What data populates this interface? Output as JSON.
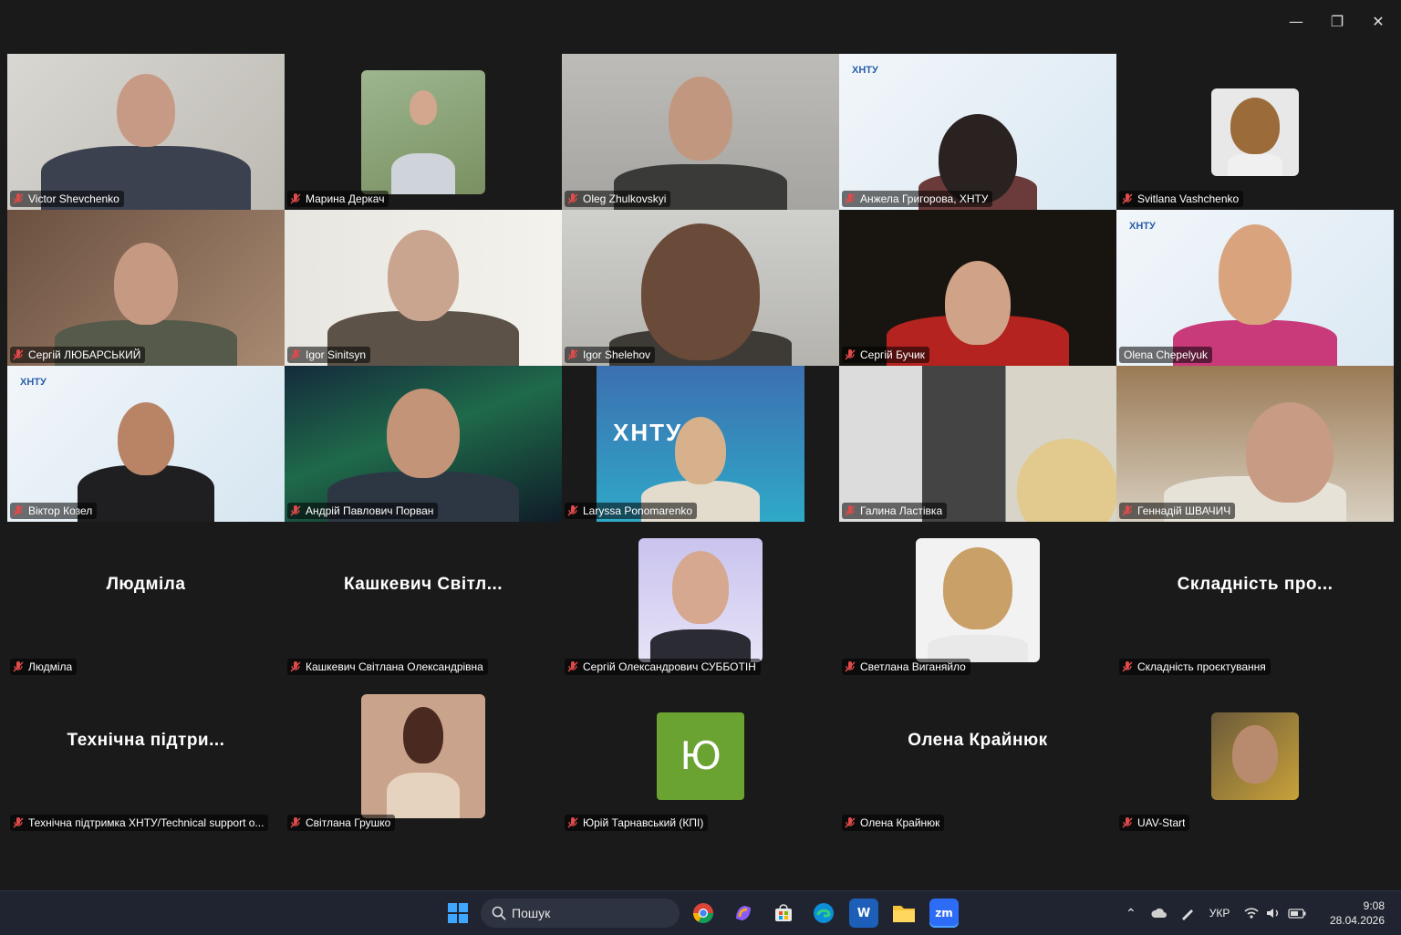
{
  "window": {
    "minimize_glyph": "—",
    "restore_glyph": "❐",
    "close_glyph": "✕"
  },
  "participants": [
    {
      "label": "Victor Shevchenko"
    },
    {
      "label": "Марина Деркач"
    },
    {
      "label": "Oleg Zhulkovskyi"
    },
    {
      "label": "Анжела Григорова, ХНТУ",
      "logo": "ХНТУ"
    },
    {
      "label": "Svitlana Vashchenko"
    },
    {
      "label": "Сергій ЛЮБАРСЬКИЙ"
    },
    {
      "label": "Igor Sinitsyn"
    },
    {
      "label": "Igor Shelehov"
    },
    {
      "label": "Сергій Бучик"
    },
    {
      "label": "Olena Chepelyuk",
      "logo": "ХНТУ"
    },
    {
      "label": "Віктор Козел",
      "logo": "ХНТУ"
    },
    {
      "label": "Андрій Павлович Порван"
    },
    {
      "label": "Laryssa Ponomarenko",
      "logo": "ХНТУ"
    },
    {
      "label": "Галина Ластівка"
    },
    {
      "label": "Геннадій ШВАЧИЧ"
    },
    {
      "label": "Людміла",
      "display_name": "Людміла"
    },
    {
      "label": "Кашкевич Світлана Олександрівна",
      "display_name": "Кашкевич Світл..."
    },
    {
      "label": "Сергій Олександрович СУББОТІН"
    },
    {
      "label": "Светлана Виганяйло"
    },
    {
      "label": "Складність проєктування",
      "display_name": "Складність про..."
    },
    {
      "label": "Технічна підтримка ХНТУ/Technical support o...",
      "display_name": "Технічна підтри..."
    },
    {
      "label": "Світлана Грушко"
    },
    {
      "label": "Юрій Тарнавський (КПІ)",
      "avatar_letter": "Ю"
    },
    {
      "label": "Олена Крайнюк",
      "display_name": "Олена Крайнюк"
    },
    {
      "label": "UAV-Start"
    }
  ],
  "taskbar": {
    "search_placeholder": "Пошук",
    "language": "УКР",
    "time": "9:08",
    "date": "28.04.2026",
    "zoom_label": "zm",
    "word_label": "W"
  }
}
